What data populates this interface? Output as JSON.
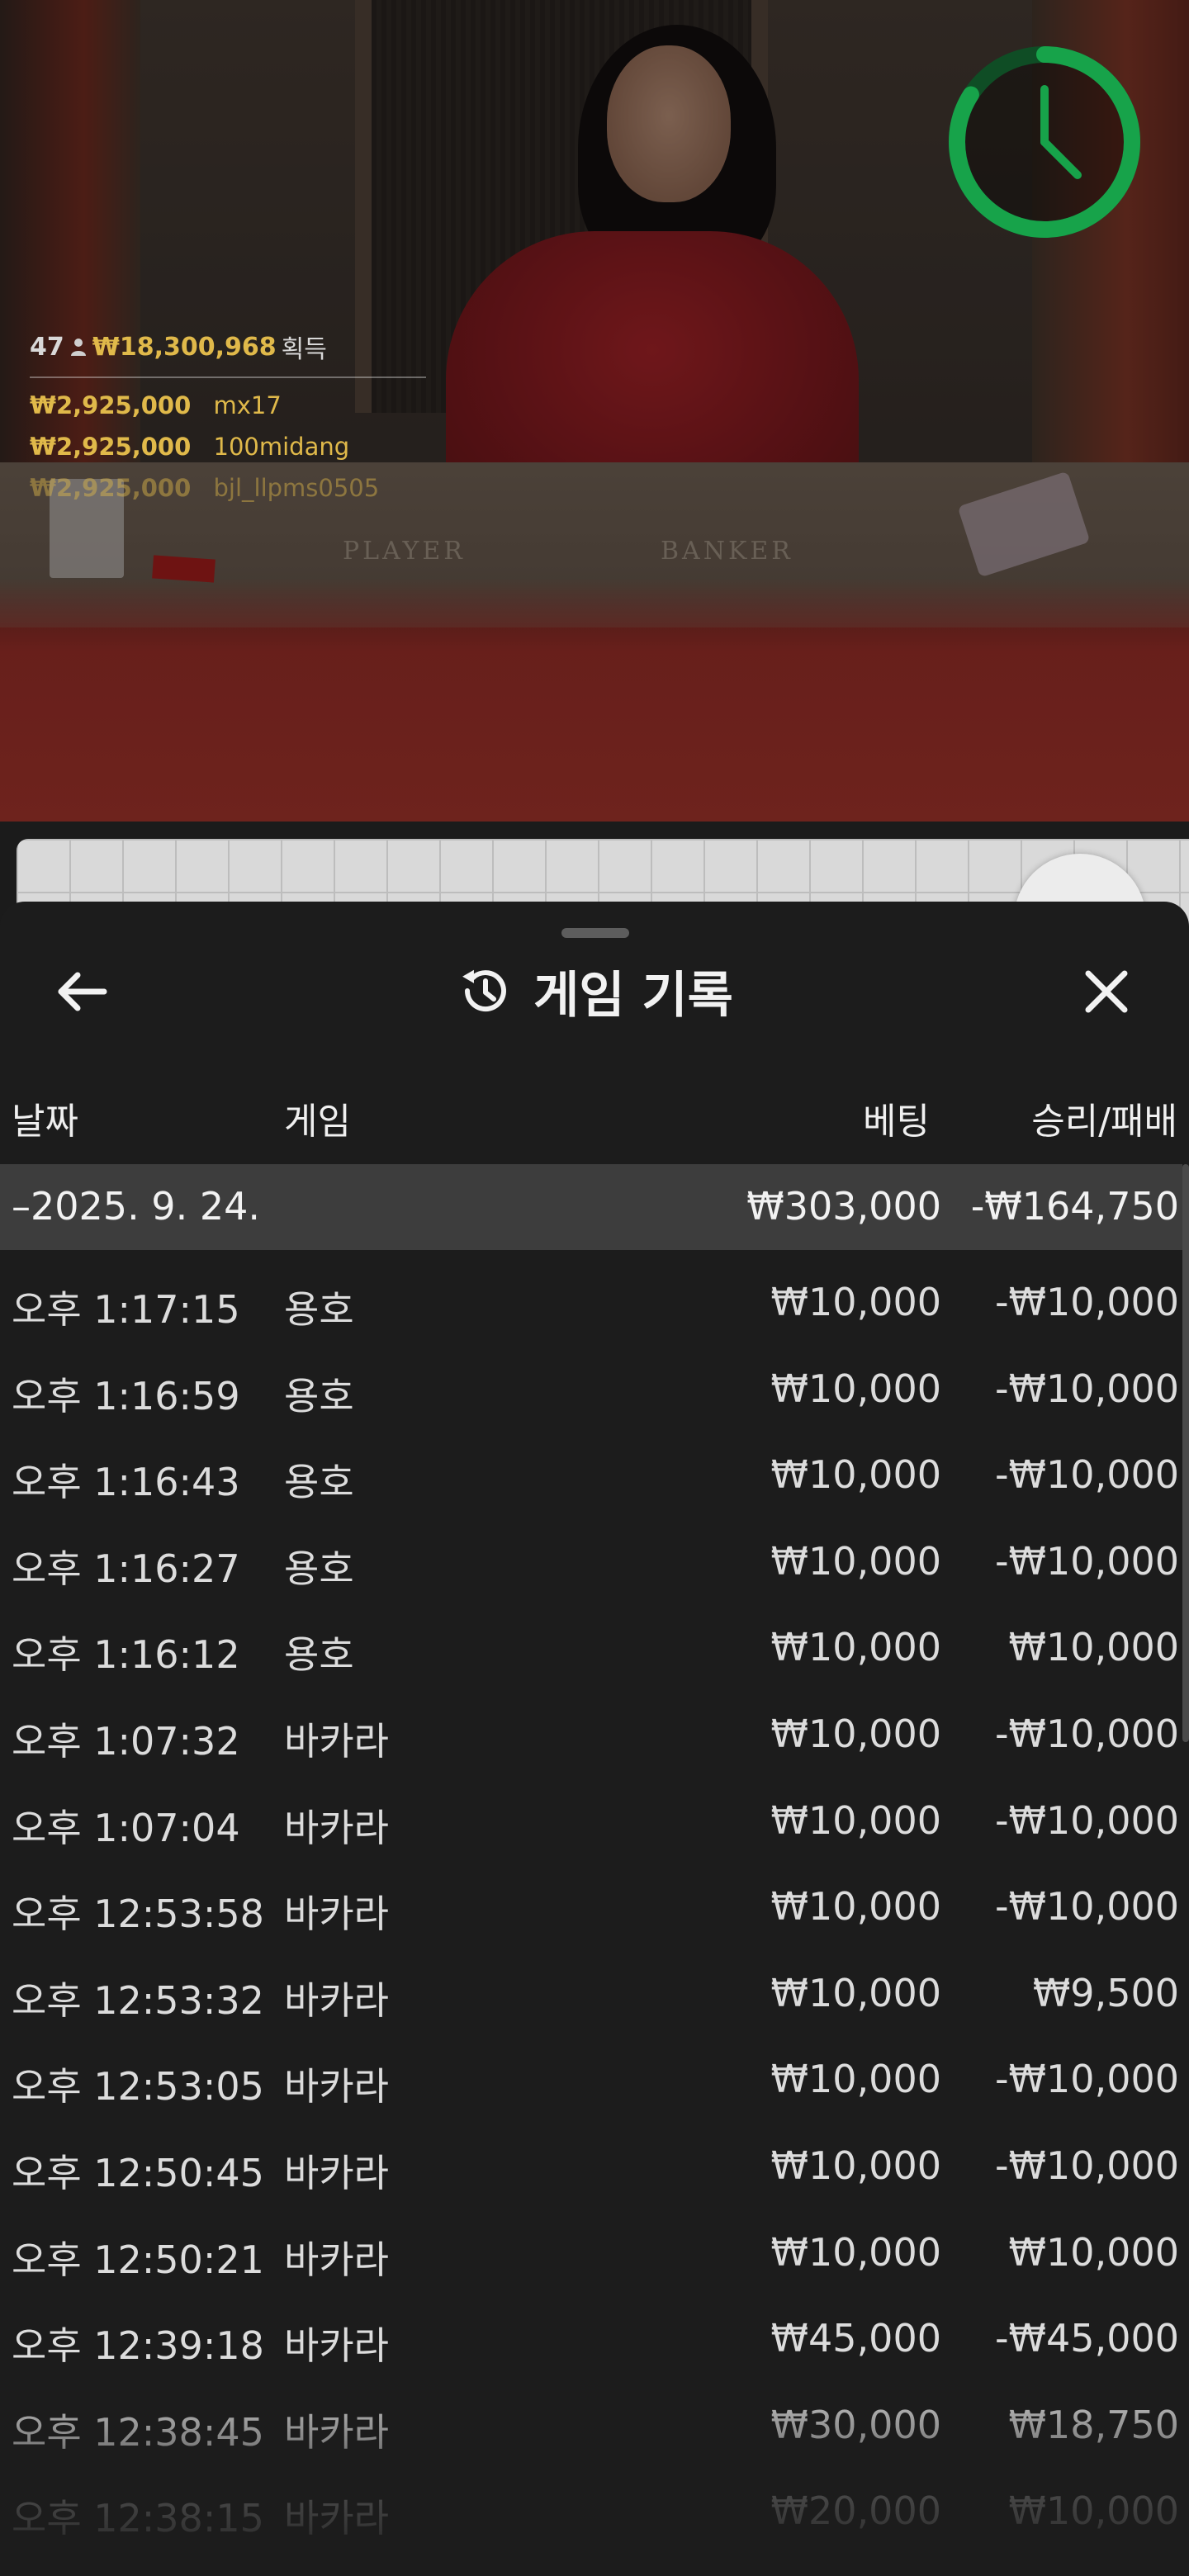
{
  "video": {
    "table_labels": {
      "player": "PLAYER",
      "banker": "BANKER"
    },
    "timer": {
      "icon": "clock-icon",
      "color": "#17a34a"
    },
    "winners": {
      "count": "47",
      "total": "₩18,300,968",
      "suffix": "획득",
      "rows": [
        {
          "amount": "₩2,925,000",
          "name": "mx17"
        },
        {
          "amount": "₩2,925,000",
          "name": "100midang"
        },
        {
          "amount": "₩2,925,000",
          "name": "bjl_llpms0505"
        }
      ]
    }
  },
  "sheet": {
    "title": "게임 기록",
    "title_icon": "history-icon",
    "back_icon": "arrow-left-icon",
    "close_icon": "close-icon",
    "columns": {
      "date": "날짜",
      "game": "게임",
      "bet": "베팅",
      "result": "승리/패배"
    },
    "date_group": {
      "label": "–2025. 9. 24.",
      "bet": "₩303,000",
      "result": "-₩164,750"
    },
    "rows": [
      {
        "time": "오후 1:17:15",
        "game": "용호",
        "bet": "₩10,000",
        "result": "-₩10,000"
      },
      {
        "time": "오후 1:16:59",
        "game": "용호",
        "bet": "₩10,000",
        "result": "-₩10,000"
      },
      {
        "time": "오후 1:16:43",
        "game": "용호",
        "bet": "₩10,000",
        "result": "-₩10,000"
      },
      {
        "time": "오후 1:16:27",
        "game": "용호",
        "bet": "₩10,000",
        "result": "-₩10,000"
      },
      {
        "time": "오후 1:16:12",
        "game": "용호",
        "bet": "₩10,000",
        "result": "₩10,000"
      },
      {
        "time": "오후 1:07:32",
        "game": "바카라",
        "bet": "₩10,000",
        "result": "-₩10,000"
      },
      {
        "time": "오후 1:07:04",
        "game": "바카라",
        "bet": "₩10,000",
        "result": "-₩10,000"
      },
      {
        "time": "오후 12:53:58",
        "game": "바카라",
        "bet": "₩10,000",
        "result": "-₩10,000"
      },
      {
        "time": "오후 12:53:32",
        "game": "바카라",
        "bet": "₩10,000",
        "result": "₩9,500"
      },
      {
        "time": "오후 12:53:05",
        "game": "바카라",
        "bet": "₩10,000",
        "result": "-₩10,000"
      },
      {
        "time": "오후 12:50:45",
        "game": "바카라",
        "bet": "₩10,000",
        "result": "-₩10,000"
      },
      {
        "time": "오후 12:50:21",
        "game": "바카라",
        "bet": "₩10,000",
        "result": "₩10,000"
      },
      {
        "time": "오후 12:39:18",
        "game": "바카라",
        "bet": "₩45,000",
        "result": "-₩45,000"
      },
      {
        "time": "오후 12:38:45",
        "game": "바카라",
        "bet": "₩30,000",
        "result": "₩18,750"
      },
      {
        "time": "오후 12:38:15",
        "game": "바카라",
        "bet": "₩20,000",
        "result": "₩10,000"
      }
    ]
  }
}
